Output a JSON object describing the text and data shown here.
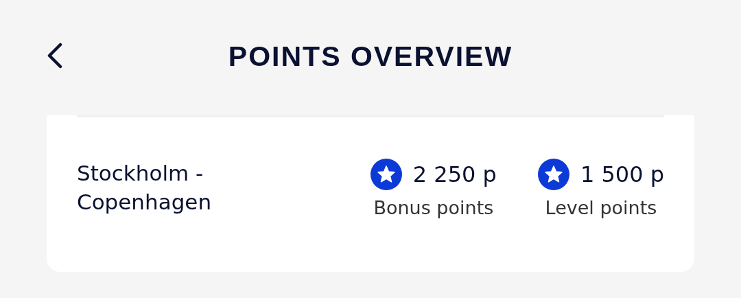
{
  "header": {
    "title": "POINTS OVERVIEW"
  },
  "flight": {
    "route": "Stockholm - Copenhagen",
    "points": [
      {
        "amount": "2 250 p",
        "label": "Bonus points"
      },
      {
        "amount": "1 500 p",
        "label": "Level points"
      }
    ]
  }
}
